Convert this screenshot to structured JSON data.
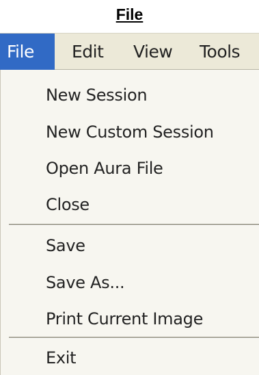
{
  "heading": "File",
  "menubar": {
    "items": [
      {
        "label": "File",
        "active": true
      },
      {
        "label": "Edit",
        "active": false
      },
      {
        "label": "View",
        "active": false
      },
      {
        "label": "Tools",
        "active": false
      }
    ]
  },
  "dropdown": {
    "groups": [
      [
        "New Session",
        "New Custom Session",
        "Open Aura File",
        "Close"
      ],
      [
        "Save",
        "Save As...",
        "Print Current Image"
      ],
      [
        "Exit"
      ]
    ]
  },
  "colors": {
    "menubar_background": "#ece9d8",
    "active_highlight": "#316ac5",
    "dropdown_background": "#f7f6f0",
    "text": "#222222"
  }
}
